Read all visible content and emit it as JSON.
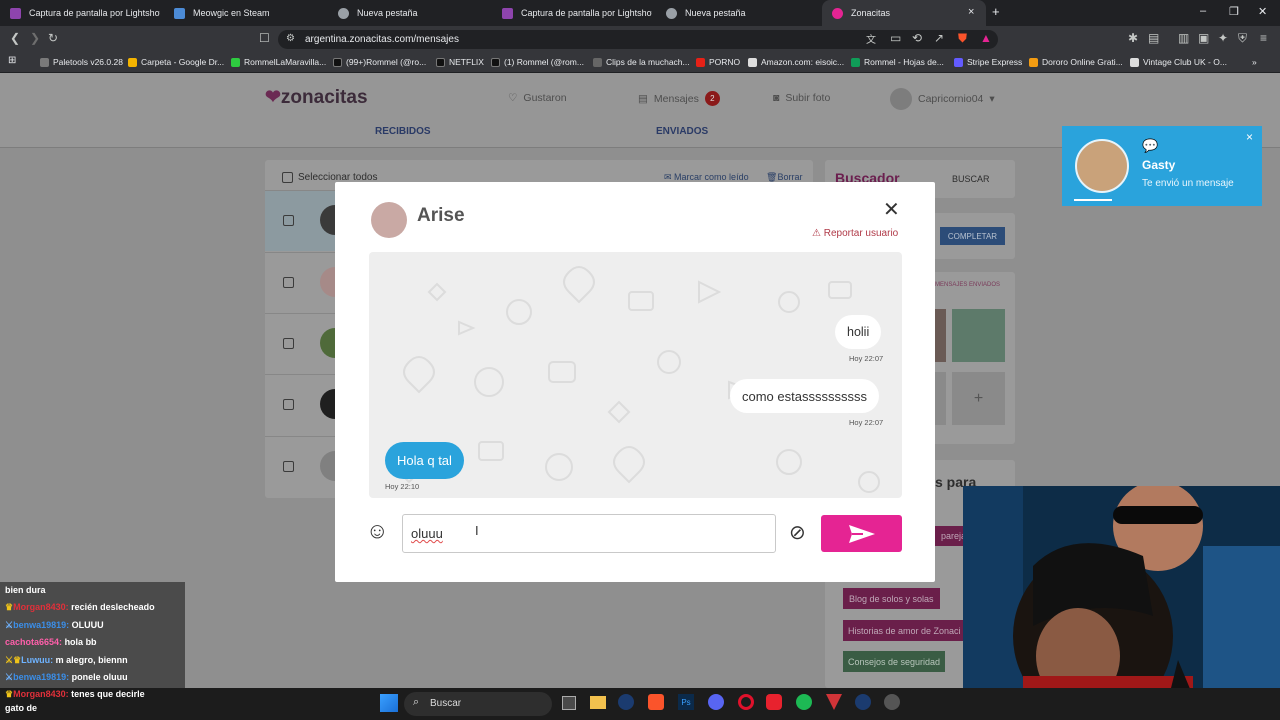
{
  "browser": {
    "tabs": [
      {
        "label": "Captura de pantalla por Lightshot",
        "color": "#8e44ad"
      },
      {
        "label": "Meowgic en Steam",
        "color": "#4c8bd6"
      },
      {
        "label": "Nueva pestaña",
        "color": "#9aa0a6"
      },
      {
        "label": "Captura de pantalla por Lightshot",
        "color": "#8e44ad"
      },
      {
        "label": "Nueva pestaña",
        "color": "#9aa0a6"
      },
      {
        "label": "Zonacitas",
        "color": "#e52493"
      }
    ],
    "new_tab": "+",
    "url": "argentina.zonacitas.com/mensajes",
    "bookmarks": [
      {
        "label": "Paletools v26.0.28",
        "color": "#7a7a7a"
      },
      {
        "label": "Carpeta - Google Dr...",
        "color": "#f4b400"
      },
      {
        "label": "RommelLaMaravilla...",
        "color": "#2ecc40"
      },
      {
        "label": "(99+)Rommel (@ro...",
        "color": "#111111"
      },
      {
        "label": "NETFLIX",
        "color": "#111111"
      },
      {
        "label": "(1) Rommel (@rom...",
        "color": "#111111"
      },
      {
        "label": "Clips de la muchach...",
        "color": "#666666"
      },
      {
        "label": "PORNO",
        "color": "#e62117"
      },
      {
        "label": "Amazon.com: eisoic...",
        "color": "#dddddd"
      },
      {
        "label": "Rommel - Hojas de...",
        "color": "#0f9d58"
      },
      {
        "label": "Stripe Express",
        "color": "#635bff"
      },
      {
        "label": "Dororo Online Grati...",
        "color": "#f39c12"
      },
      {
        "label": "Vintage Club UK - O...",
        "color": "#dddddd"
      }
    ]
  },
  "site": {
    "logo": "zonacitas",
    "nav": {
      "gustaron": "Gustaron",
      "mensajes": "Mensajes",
      "mensajes_count": "2",
      "subir_foto": "Subir foto",
      "user": "Capricornio04"
    },
    "subnav": {
      "recibidos": "RECIBIDOS",
      "enviados": "ENVIADOS"
    },
    "inbox": {
      "select_all": "Seleccionar todos",
      "mark_read": "Marcar como leído",
      "delete": "Borrar"
    },
    "sidebar": {
      "buscador": "Buscador",
      "buscar": "BUSCAR",
      "completar": "COMPLETAR",
      "enviados_hint": "MENSAJES ENVIADOS",
      "plus": "+",
      "para_heading": "s para",
      "links": [
        "pareja",
        "Blog de solos y solas",
        "Historias de amor de Zonaci",
        "Consejos de seguridad"
      ]
    },
    "notification": {
      "name": "Gasty",
      "text": "Te envió un mensaje",
      "close": "×"
    }
  },
  "modal": {
    "user_name": "Arise",
    "close": "✕",
    "report": "Reportar usuario",
    "messages": [
      {
        "text": "holii",
        "time": "Hoy 22:07",
        "side": "right"
      },
      {
        "text": "como estassssssssss",
        "time": "Hoy 22:07",
        "side": "right"
      },
      {
        "text": "Hola q tal",
        "time": "Hoy 22:10",
        "side": "left"
      }
    ],
    "input_value": "oluuu"
  },
  "stream_chat": [
    {
      "user": "",
      "msg": "bien dura",
      "color": "#ffffff"
    },
    {
      "user": "Morgan8430:",
      "msg": "recién deslecheado",
      "color": "#e0303a"
    },
    {
      "user": "benwa19819:",
      "msg": "OLUUU",
      "color": "#3b8ee8"
    },
    {
      "user": "cachota6654:",
      "msg": "hola bb",
      "color": "#ff5faa"
    },
    {
      "user": "Luwuu:",
      "msg": "m alegro, biennn",
      "color": "#6fb3ff"
    },
    {
      "user": "benwa19819:",
      "msg": "ponele oluuu",
      "color": "#3b8ee8"
    },
    {
      "user": "Morgan8430:",
      "msg": "tenes que decirle",
      "color": "#e0303a"
    },
    {
      "user": "",
      "msg": "gato de",
      "color": "#ffffff"
    }
  ],
  "taskbar": {
    "search": "Buscar"
  }
}
